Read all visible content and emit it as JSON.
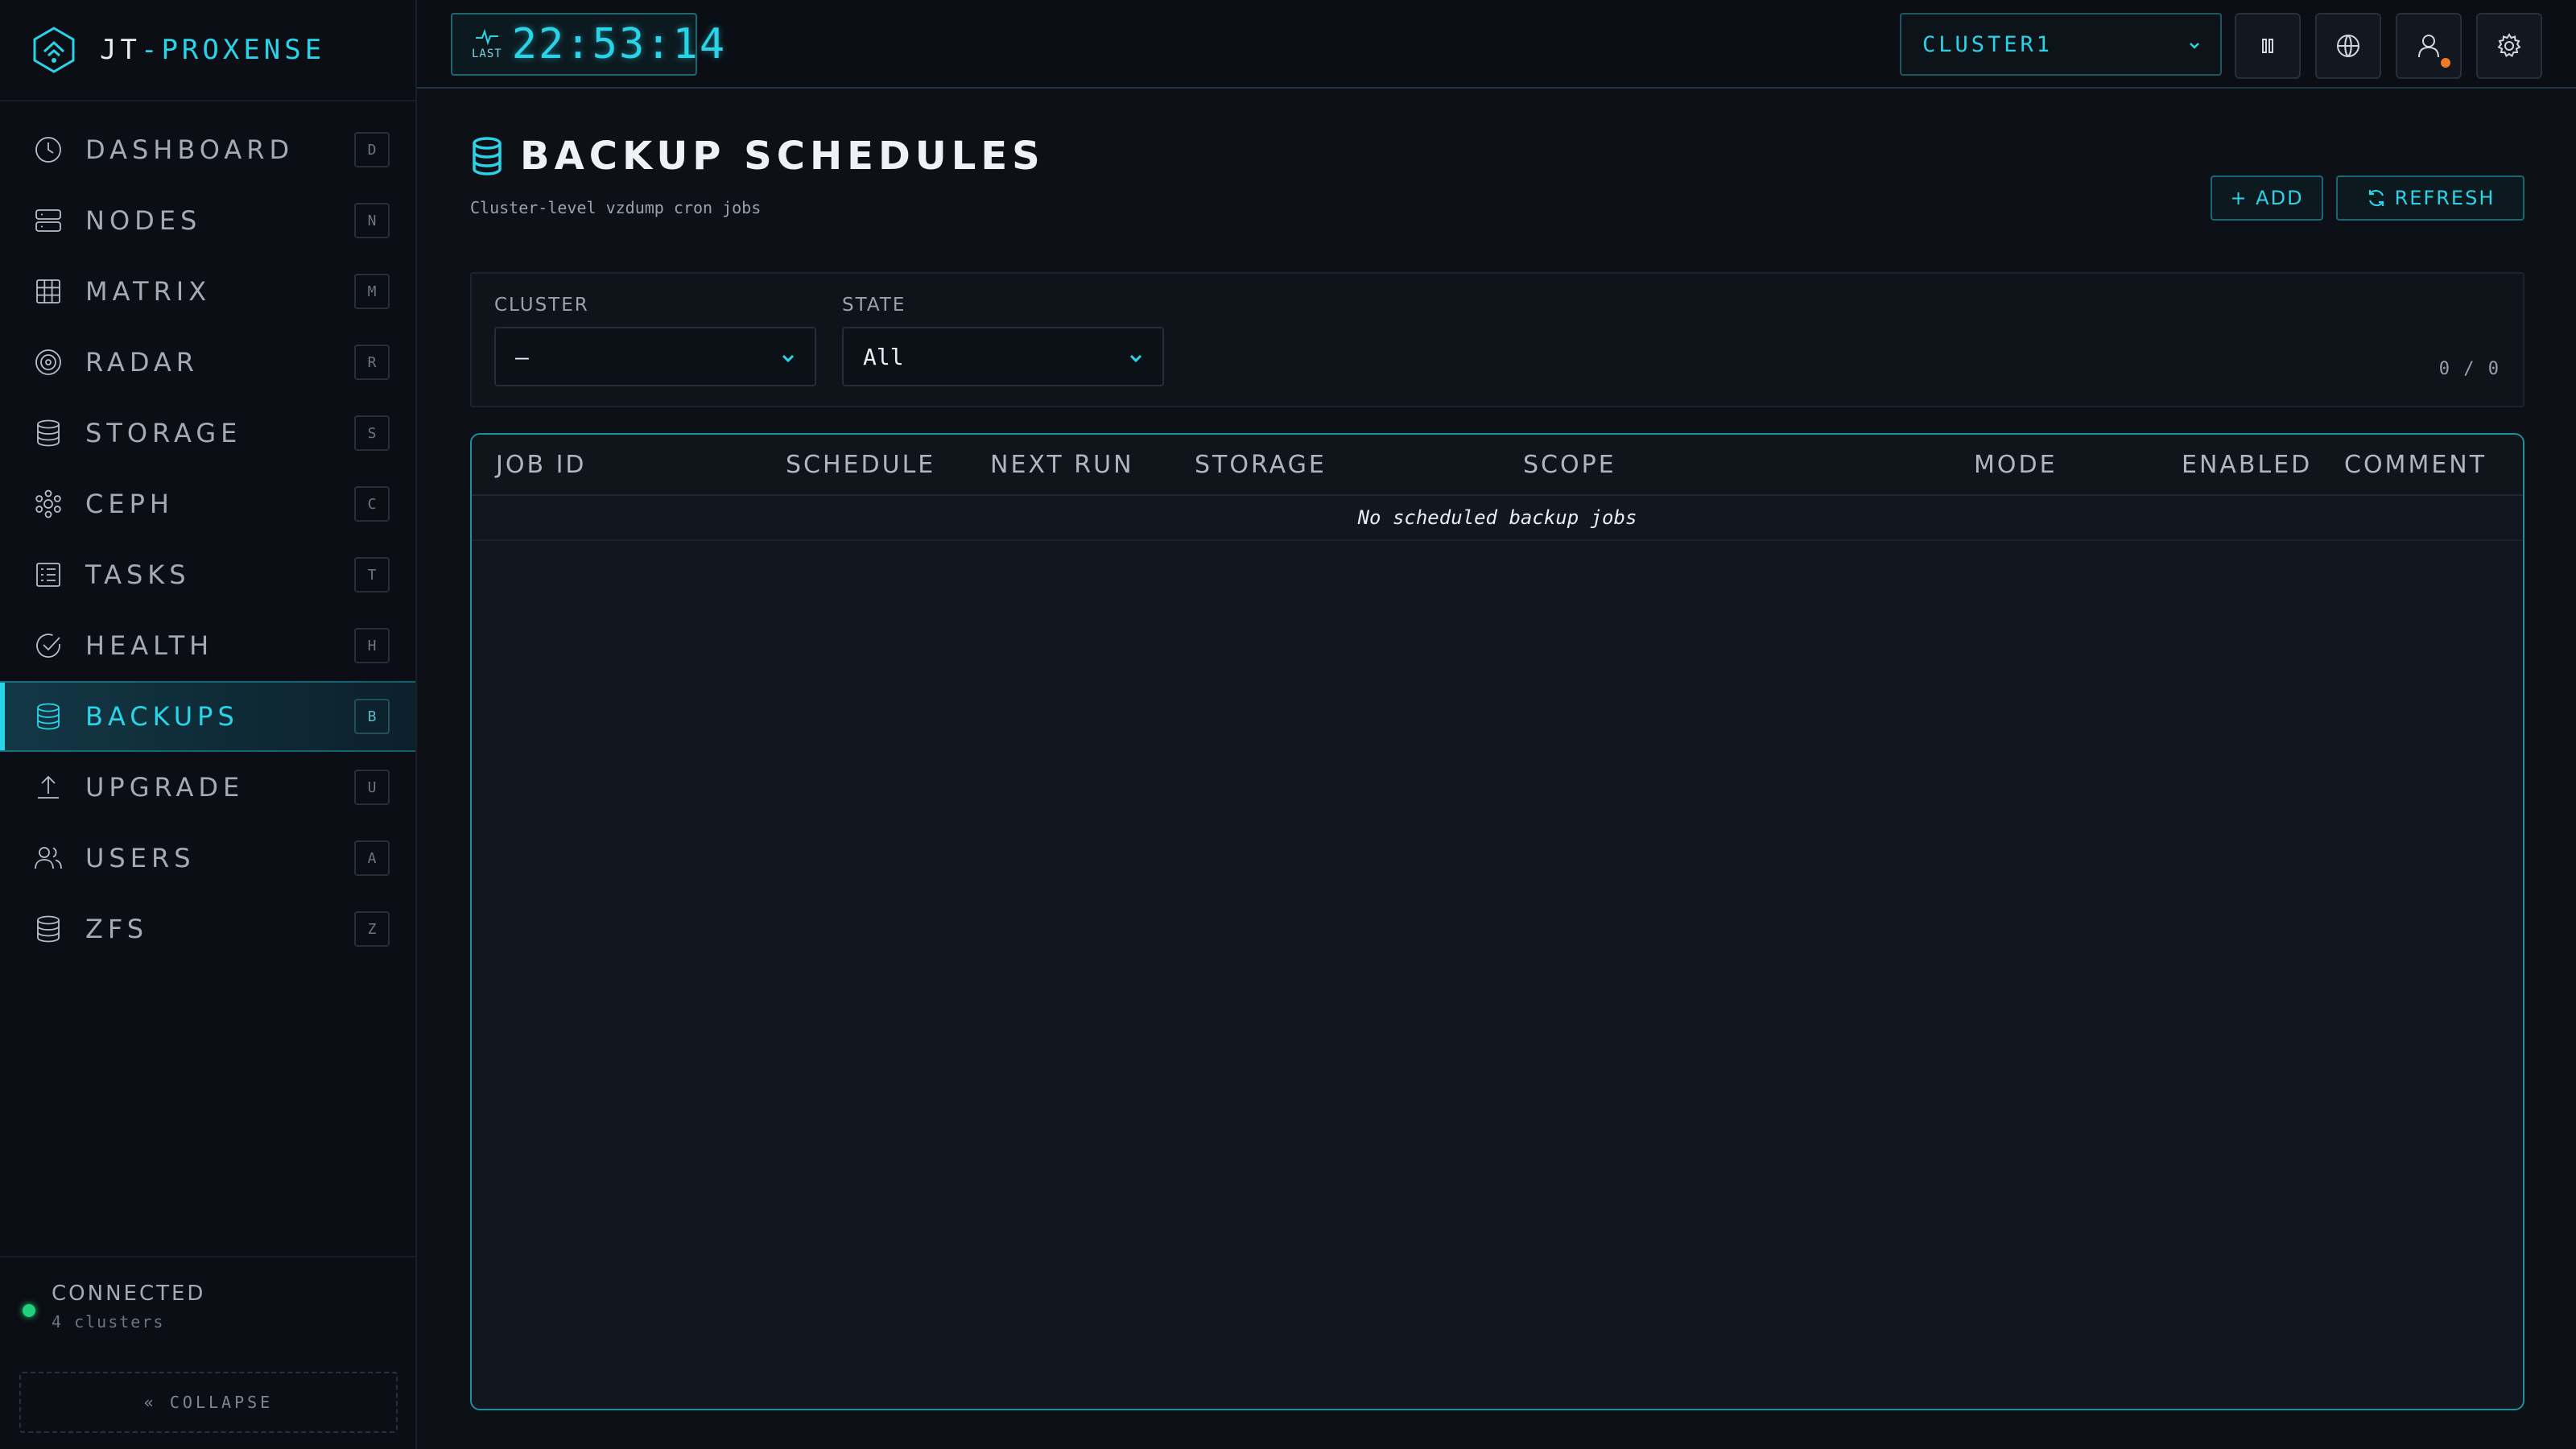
{
  "app": {
    "brand_prefix": "JT",
    "brand_sep": "-",
    "brand_name": "PROXENSE"
  },
  "sidebar": {
    "items": [
      {
        "label": "DASHBOARD",
        "key": "D",
        "icon": "clock-icon"
      },
      {
        "label": "NODES",
        "key": "N",
        "icon": "server-icon"
      },
      {
        "label": "MATRIX",
        "key": "M",
        "icon": "grid-icon"
      },
      {
        "label": "RADAR",
        "key": "R",
        "icon": "radar-icon"
      },
      {
        "label": "STORAGE",
        "key": "S",
        "icon": "database-icon"
      },
      {
        "label": "CEPH",
        "key": "C",
        "icon": "ceph-icon"
      },
      {
        "label": "TASKS",
        "key": "T",
        "icon": "task-list-icon"
      },
      {
        "label": "HEALTH",
        "key": "H",
        "icon": "check-circle-icon"
      },
      {
        "label": "BACKUPS",
        "key": "B",
        "icon": "database-icon",
        "active": true
      },
      {
        "label": "UPGRADE",
        "key": "U",
        "icon": "upload-icon"
      },
      {
        "label": "USERS",
        "key": "A",
        "icon": "users-icon"
      },
      {
        "label": "ZFS",
        "key": "Z",
        "icon": "database-icon"
      }
    ],
    "status": {
      "label": "CONNECTED",
      "detail": "4 clusters"
    },
    "collapse_label": "« COLLAPSE"
  },
  "topbar": {
    "clock_caption": "LAST",
    "clock_time": "22:53:14",
    "cluster_selected": "CLUSTER1"
  },
  "page": {
    "title": "BACKUP SCHEDULES",
    "subtitle": "Cluster-level vzdump cron jobs",
    "add_label": "+ ADD",
    "refresh_label": "REFRESH"
  },
  "filters": {
    "cluster_label": "CLUSTER",
    "cluster_value": "—",
    "state_label": "STATE",
    "state_value": "All",
    "count": "0 / 0"
  },
  "table": {
    "columns": [
      "JOB ID",
      "SCHEDULE",
      "NEXT RUN",
      "STORAGE",
      "SCOPE",
      "MODE",
      "ENABLED",
      "COMMENT"
    ],
    "empty_message": "No scheduled backup jobs"
  },
  "colors": {
    "accent": "#2ad4e8",
    "background": "#0d1016",
    "status_ok": "#21d07a",
    "notification": "#f07b27"
  }
}
